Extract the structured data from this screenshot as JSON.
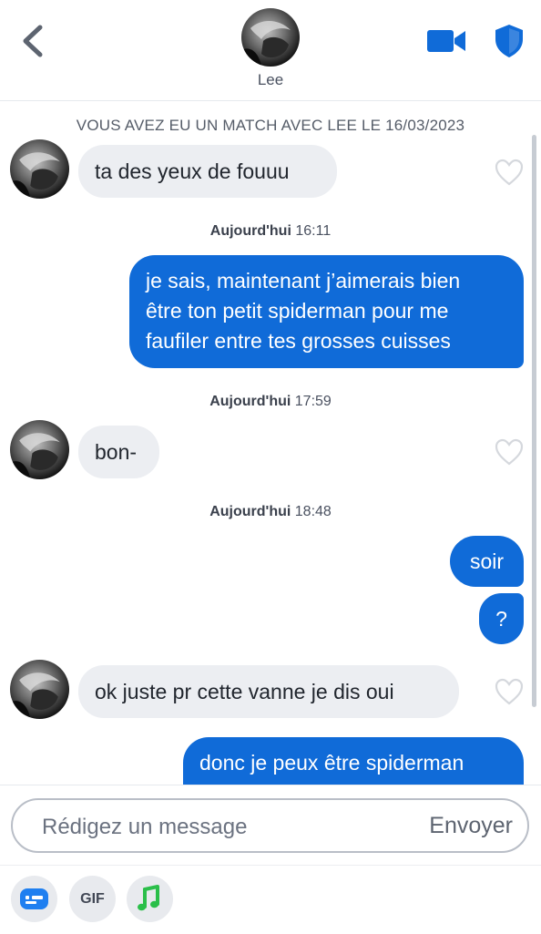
{
  "header": {
    "contact_name": "Lee",
    "icons": {
      "back": "chevron-left-icon",
      "video": "video-camera-icon",
      "safety": "shield-icon"
    },
    "colors": {
      "accent": "#106bd8",
      "icon_back": "#5d6470"
    }
  },
  "chat": {
    "match_notice": "VOUS AVEZ EU UN MATCH AVEC LEE LE 16/03/2023",
    "timestamps": [
      {
        "day": "Aujourd'hui",
        "time": "16:11"
      },
      {
        "day": "Aujourd'hui",
        "time": "17:59"
      },
      {
        "day": "Aujourd'hui",
        "time": "18:48"
      }
    ],
    "messages": [
      {
        "from": "them",
        "text": "ta des yeux de fouuu"
      },
      {
        "from": "me",
        "lines": [
          "je sais, maintenant j’aimerais bien",
          "être ton petit spiderman pour me",
          "faufiler entre tes grosses cuisses"
        ]
      },
      {
        "from": "them",
        "text": "bon-"
      },
      {
        "from": "me",
        "text": "soir"
      },
      {
        "from": "me",
        "text": "?"
      },
      {
        "from": "them",
        "text": "ok juste pr cette vanne je dis oui"
      },
      {
        "from": "me",
        "text": "donc je peux être spiderman"
      }
    ],
    "colors": {
      "incoming_bubble": "#eceef2",
      "outgoing_bubble": "#106bd8"
    }
  },
  "composer": {
    "placeholder": "Rédigez un message",
    "value": "",
    "send_label": "Envoyer"
  },
  "toolbar": {
    "gif_label": "GIF",
    "icons": {
      "sticker": "sticker-card-icon",
      "gif": "gif-icon",
      "music": "music-note-icon"
    },
    "colors": {
      "sticker": "#1f7ff0",
      "music": "#2bbf4a"
    }
  }
}
